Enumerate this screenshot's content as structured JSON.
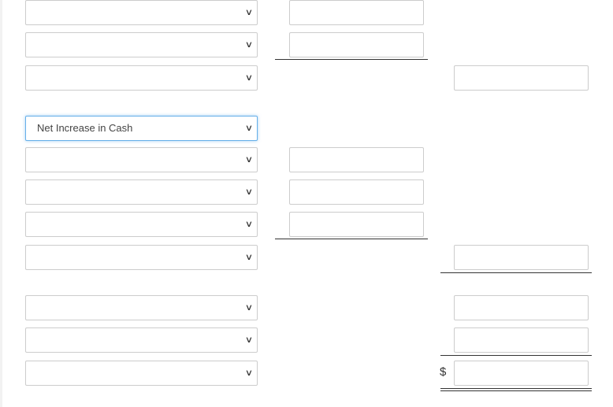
{
  "rows": [
    {
      "select": ""
    },
    {
      "select": ""
    },
    {
      "select": ""
    },
    {
      "select": "Net Increase in Cash"
    },
    {
      "select": ""
    },
    {
      "select": ""
    },
    {
      "select": ""
    },
    {
      "select": ""
    },
    {
      "select": ""
    },
    {
      "select": ""
    },
    {
      "select": ""
    }
  ],
  "currency_symbol": "$",
  "icons": {
    "dropdown": "chevron-down-icon"
  }
}
